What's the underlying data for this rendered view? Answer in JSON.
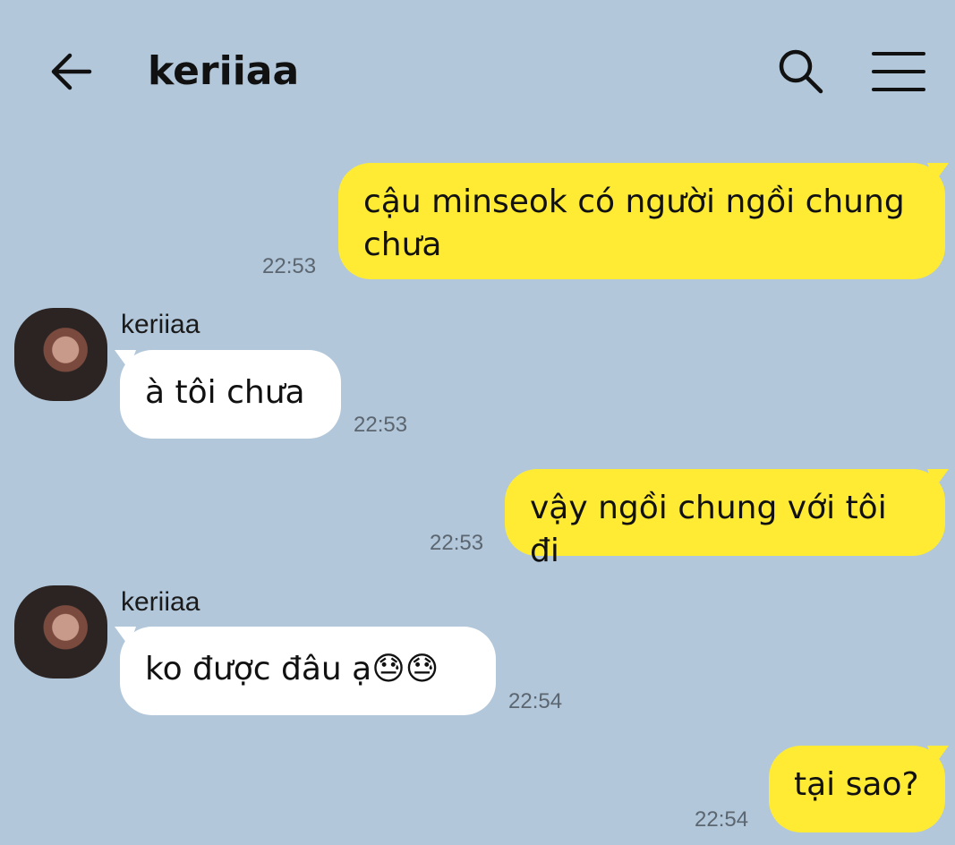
{
  "header": {
    "title": "keriiaa"
  },
  "messages": [
    {
      "side": "right",
      "text": "cậu minseok có người ngồi chung chưa",
      "time": "22:53"
    },
    {
      "side": "left",
      "sender": "keriiaa",
      "text": "à tôi chưa",
      "time": "22:53"
    },
    {
      "side": "right",
      "text": "vậy ngồi chung với tôi đi",
      "time": "22:53"
    },
    {
      "side": "left",
      "sender": "keriiaa",
      "text": "ko được đâu ạ😓😓",
      "time": "22:54"
    },
    {
      "side": "right",
      "text": "tại sao?",
      "time": "22:54"
    }
  ],
  "colors": {
    "background": "#b2c7da",
    "my_bubble": "#ffeb33",
    "their_bubble": "#ffffff"
  },
  "icons": [
    "back-arrow-icon",
    "search-icon",
    "menu-icon"
  ]
}
